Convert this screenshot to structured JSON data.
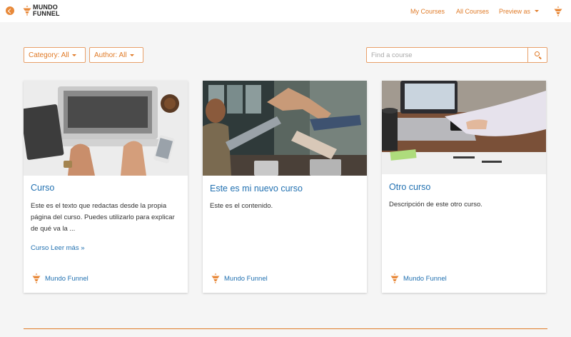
{
  "header": {
    "logo_text_line1": "MUNDO",
    "logo_text_line2": "FUNNEL",
    "nav": {
      "my_courses": "My Courses",
      "all_courses": "All Courses",
      "preview_as": "Preview as"
    }
  },
  "filters": {
    "category": "Category: All",
    "author": "Author: All"
  },
  "search": {
    "placeholder": "Find a course"
  },
  "courses": [
    {
      "title": "Curso",
      "description": "Este es el texto que redactas desde la propia página del curso. Puedes utilizarlo para explicar de qué va la ...",
      "read_more": "Curso Leer más »",
      "author": "Mundo Funnel"
    },
    {
      "title": "Este es mi nuevo curso",
      "description": "Este es el contenido.",
      "author": "Mundo Funnel"
    },
    {
      "title": "Otro curso",
      "description": "Descripción de este otro curso.",
      "author": "Mundo Funnel"
    }
  ],
  "colors": {
    "accent": "#e07b28",
    "link": "#2271b1",
    "background": "#f5f5f5"
  },
  "icons": {
    "back": "back-arrow-icon",
    "logo": "funnel-logo-icon",
    "search": "search-icon",
    "dropdown": "chevron-down-icon"
  }
}
